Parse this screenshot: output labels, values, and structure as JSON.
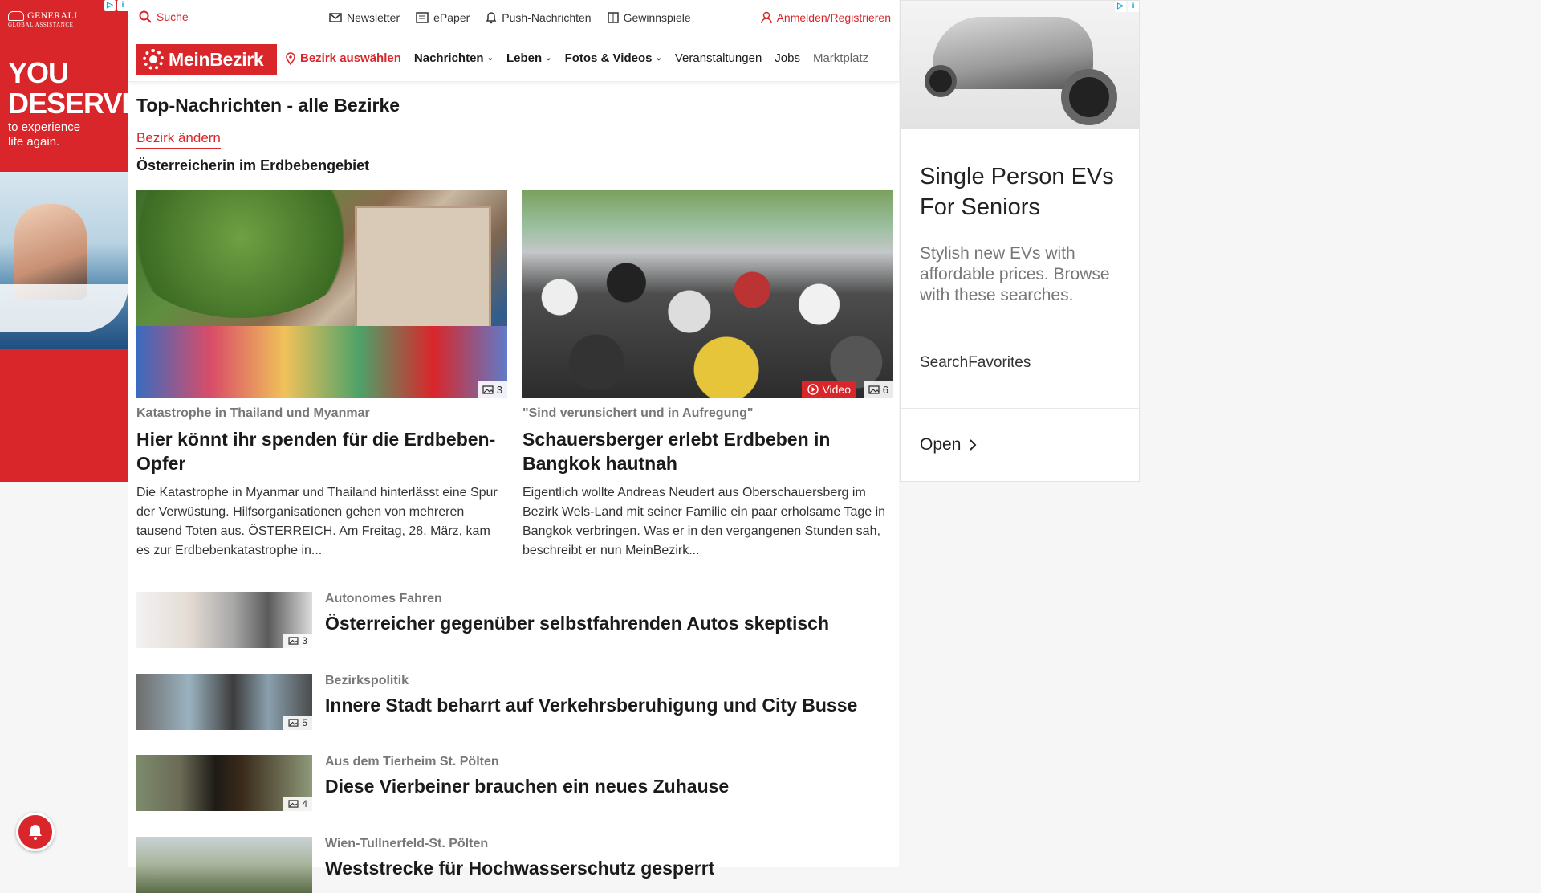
{
  "ad_left": {
    "brand": "GENERALI",
    "brand_sub": "GLOBAL ASSISTANCE",
    "headline": "YOU DESERVE",
    "subline": "to experience life again."
  },
  "topbar": {
    "search": "Suche",
    "links": [
      "Newsletter",
      "ePaper",
      "Push-Nachrichten",
      "Gewinnspiele"
    ],
    "login": "Anmelden/Registrieren"
  },
  "nav": {
    "logo": "MeinBezirk",
    "bezirk": "Bezirk auswählen",
    "items": [
      "Nachrichten",
      "Leben",
      "Fotos & Videos",
      "Veranstaltungen",
      "Jobs",
      "Marktplatz"
    ]
  },
  "page": {
    "title": "Top-Nachrichten - alle Bezirke",
    "change_link": "Bezirk ändern",
    "section_title": "Österreicherin im Erdbebengebiet"
  },
  "cards": [
    {
      "kicker": "Katastrophe in Thailand und Myanmar",
      "headline": "Hier könnt ihr spenden für die Erdbeben-Opfer",
      "teaser": "Die Katastrophe in Myanmar und Thailand hinterlässt eine Spur der Verwüstung. Hilfsorganisationen gehen von mehreren tausend Toten aus.  ÖSTERREICH. Am Freitag, 28. März, kam es zur Erdbebenkatastrophe in...",
      "photo_count": "3"
    },
    {
      "kicker": "\"Sind verunsichert und in Aufregung\"",
      "headline": "Schauersberger erlebt Erdbeben in Bangkok hautnah",
      "teaser": "Eigentlich wollte Andreas Neudert aus Oberschauersberg im Bezirk Wels-Land mit seiner Familie ein paar erholsame Tage in Bangkok verbringen. Was er in den vergangenen Stunden sah, beschreibt er nun MeinBezirk...",
      "video_label": "Video",
      "photo_count": "6"
    }
  ],
  "list": [
    {
      "kicker": "Autonomes Fahren",
      "headline": "Österreicher gegenüber selbstfahrenden Autos skeptisch",
      "photo_count": "3"
    },
    {
      "kicker": "Bezirkspolitik",
      "headline": "Innere Stadt beharrt auf Verkehrsberuhigung und City Busse",
      "photo_count": "5"
    },
    {
      "kicker": "Aus dem Tierheim St. Pölten",
      "headline": "Diese Vierbeiner brauchen ein neues Zuhause",
      "photo_count": "4"
    },
    {
      "kicker": "Wien-Tullnerfeld-St. Pölten",
      "headline": "Weststrecke für Hochwasserschutz gesperrt"
    }
  ],
  "ad_right": {
    "title": "Single Person EVs For Seniors",
    "description": "Stylish new EVs with affordable prices. Browse with these searches.",
    "sponsor": "SearchFavorites",
    "cta": "Open"
  },
  "colors": {
    "brand": "#d9262a"
  }
}
